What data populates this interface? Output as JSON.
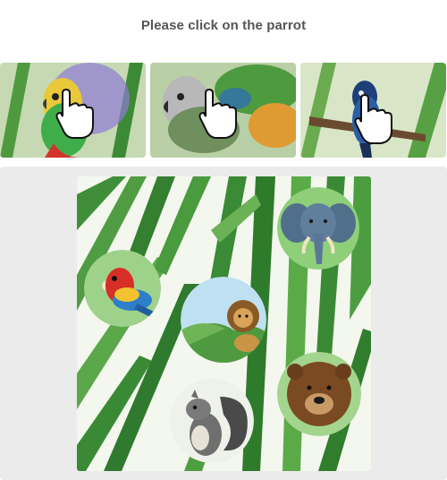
{
  "prompt": {
    "text": "Please click on the parrot"
  },
  "examples": [
    {
      "name": "parrot-example-green"
    },
    {
      "name": "parrot-example-grey"
    },
    {
      "name": "parrot-example-blue"
    }
  ],
  "board": {
    "background": "jungle-leaves",
    "animals": [
      "parrot",
      "lion",
      "elephant",
      "squirrel",
      "bear"
    ]
  },
  "colors": {
    "prompt_text": "#555555",
    "stage_background": "#ebebeb",
    "leaf_green": "#3f8f3a"
  }
}
